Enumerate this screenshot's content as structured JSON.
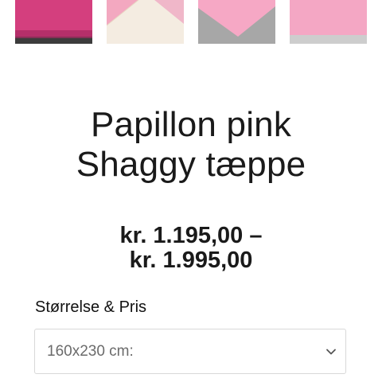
{
  "gallery": {
    "thumbnails": [
      {
        "alt": "",
        "colors": {
          "bg": "#3a3a3a",
          "rug": "#d23a79"
        }
      },
      {
        "alt": "",
        "colors": {
          "bg": "#f1e6d7",
          "rug": "#f2a7bf"
        }
      },
      {
        "alt": "",
        "colors": {
          "bg": "#a9a9a9",
          "rug": "#f59fbf"
        }
      },
      {
        "alt": "",
        "colors": {
          "bg": "#cfcfcf",
          "rug": "#f29cbd"
        }
      }
    ]
  },
  "product": {
    "title_line1": "Papillon pink",
    "title_line2": "Shaggy tæppe",
    "price_line1": "kr. 1.195,00 –",
    "price_line2": "kr. 1.995,00"
  },
  "variation": {
    "label": "Størrelse & Pris",
    "selected": "160x230 cm:"
  },
  "icons": {
    "dropdown": "chevron-down-icon"
  },
  "colors": {
    "text": "#1a1a1a",
    "select_border": "#d8d8d8",
    "select_text": "#6b6b6b"
  }
}
